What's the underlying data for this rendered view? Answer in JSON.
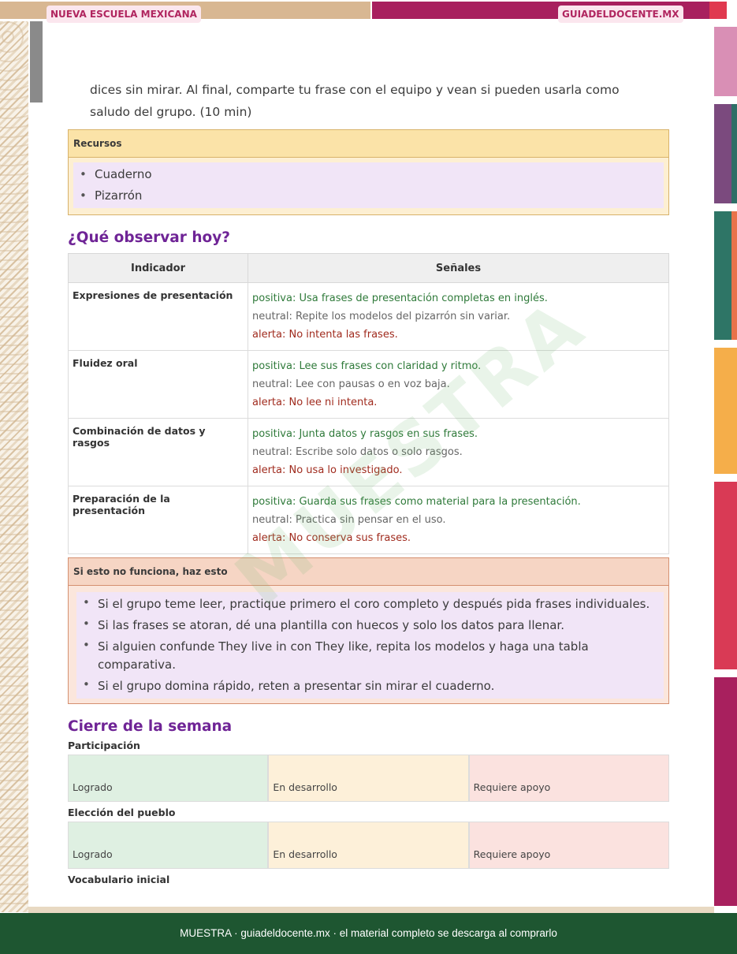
{
  "header": {
    "left_tag": "NUEVA ESCUELA MEXICANA",
    "right_tag": "GUIADELDOCENTE.MX"
  },
  "intro_text": "dices sin mirar. Al final, comparte tu frase con el equipo y vean si pueden usarla como saludo del grupo. (10 min)",
  "recursos": {
    "title": "Recursos",
    "items": [
      "Cuaderno",
      "Pizarrón"
    ]
  },
  "observar": {
    "heading": "¿Qué observar hoy?",
    "col_indicador": "Indicador",
    "col_senales": "Señales",
    "rows": [
      {
        "indicador": "Expresiones de presentación",
        "positiva": "positiva: Usa frases de presentación completas en inglés.",
        "neutral": "neutral: Repite los modelos del pizarrón sin variar.",
        "alerta": "alerta: No intenta las frases."
      },
      {
        "indicador": "Fluidez oral",
        "positiva": "positiva: Lee sus frases con claridad y ritmo.",
        "neutral": "neutral: Lee con pausas o en voz baja.",
        "alerta": "alerta: No lee ni intenta."
      },
      {
        "indicador": "Combinación de datos y rasgos",
        "positiva": "positiva: Junta datos y rasgos en sus frases.",
        "neutral": "neutral: Escribe solo datos o solo rasgos.",
        "alerta": "alerta: No usa lo investigado."
      },
      {
        "indicador": "Preparación de la presentación",
        "positiva": "positiva: Guarda sus frases como material para la presentación.",
        "neutral": "neutral: Practica sin pensar en el uso.",
        "alerta": "alerta: No conserva sus frases."
      }
    ]
  },
  "alternativas": {
    "title": "Si esto no funciona, haz esto",
    "items": [
      "Si el grupo teme leer, practique primero el coro completo y después pida frases individuales.",
      "Si las frases se atoran, dé una plantilla con huecos y solo los datos para llenar.",
      "Si alguien confunde They live in con They like, repita los modelos y haga una tabla comparativa.",
      "Si el grupo domina rápido, reten a presentar sin mirar el cuaderno."
    ]
  },
  "cierre": {
    "heading": "Cierre de la semana",
    "rubrics": [
      {
        "label": "Participación",
        "levels": [
          "Logrado",
          "En desarrollo",
          "Requiere apoyo"
        ]
      },
      {
        "label": "Elección del pueblo",
        "levels": [
          "Logrado",
          "En desarrollo",
          "Requiere apoyo"
        ]
      }
    ],
    "next_label": "Vocabulario inicial"
  },
  "watermark": "MUESTRA",
  "footer": "MUESTRA · guiadeldocente.mx · el material completo se descarga al comprarlo",
  "colors": {
    "heading_purple": "#6f2496",
    "positive_green": "#2f7a3a",
    "alert_red": "#a02b1e",
    "footer_green": "#1e5631"
  }
}
